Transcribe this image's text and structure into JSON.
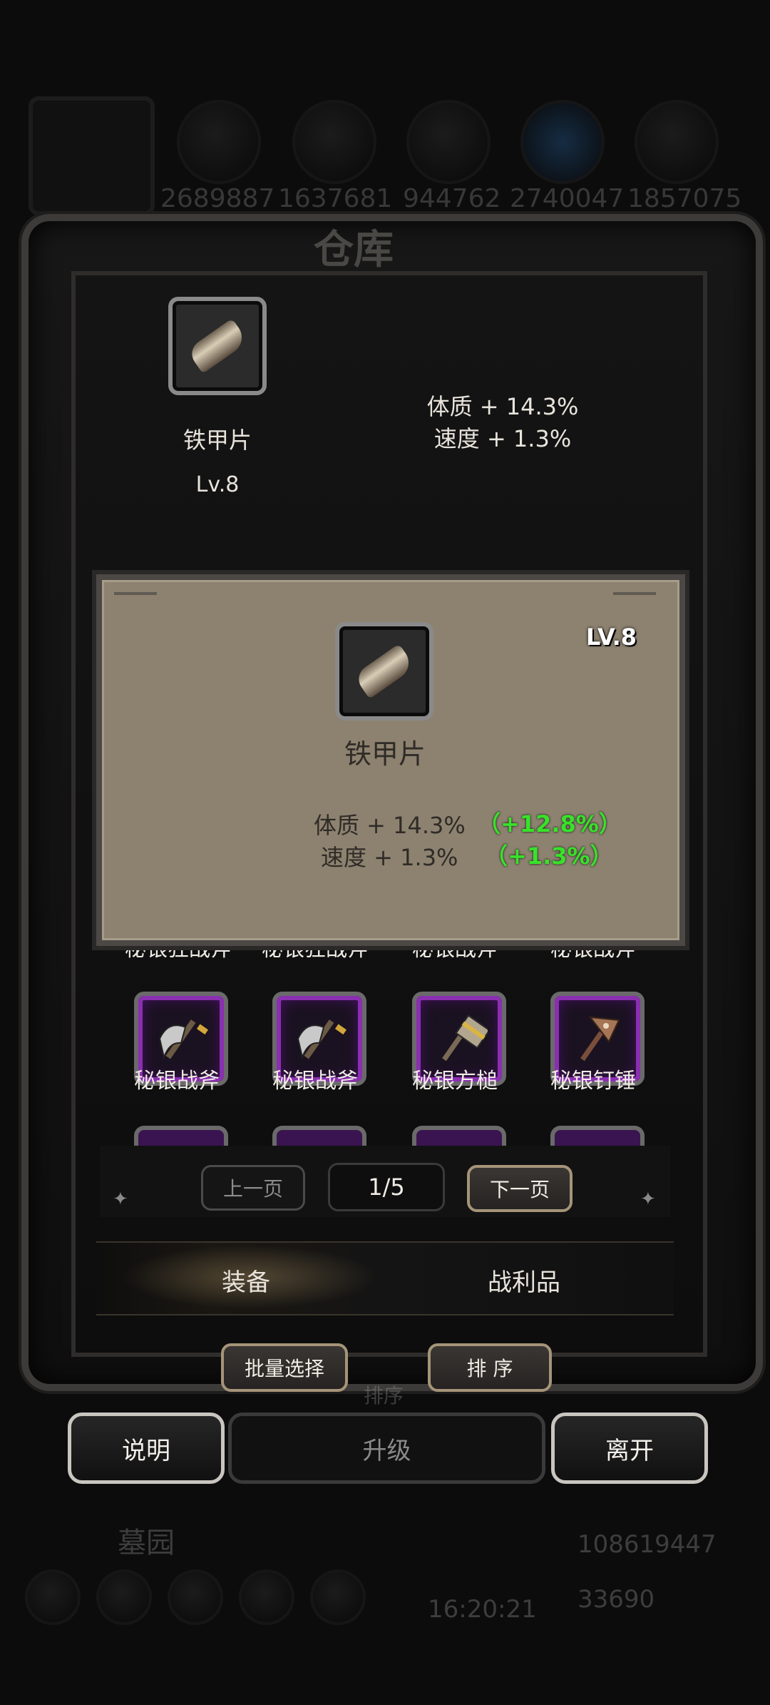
{
  "background": {
    "resources": [
      "2689887",
      "1637681",
      "944762",
      "2740047",
      "1857075"
    ],
    "warehouse_title": "仓库",
    "area_name": "墓园",
    "gold": "108619447",
    "gems": "33690",
    "clock": "16:20:21",
    "sort_ghost": "排序"
  },
  "selected": {
    "name": "铁甲片",
    "level": "Lv.8",
    "stat1": "体质 + 14.3%",
    "stat2": "速度 + 1.3%"
  },
  "card": {
    "level": "LV.8",
    "name": "铁甲片",
    "stat1": "体质 + 14.3%",
    "stat2": "速度 + 1.3%",
    "bonus1": "（+12.8%）",
    "bonus2": "（+1.3%）",
    "bonus_color": "#38e22a"
  },
  "grid": {
    "partial_row": [
      "秘银狂战斧",
      "秘银狂战斧",
      "秘银战斧",
      "秘银战斧"
    ],
    "row": [
      "秘银战斧",
      "秘银战斧",
      "秘银方槌",
      "秘银钉锤"
    ],
    "icons": [
      "axe-icon",
      "axe-icon",
      "hammer-icon",
      "mace-icon"
    ]
  },
  "pagination": {
    "prev": "上一页",
    "page": "1/5",
    "next": "下一页"
  },
  "tabs": {
    "equipment": "装备",
    "loot": "战利品"
  },
  "actions": {
    "batch_select": "批量选择",
    "sort": "排 序",
    "help": "说明",
    "upgrade": "升级",
    "leave": "离开"
  }
}
